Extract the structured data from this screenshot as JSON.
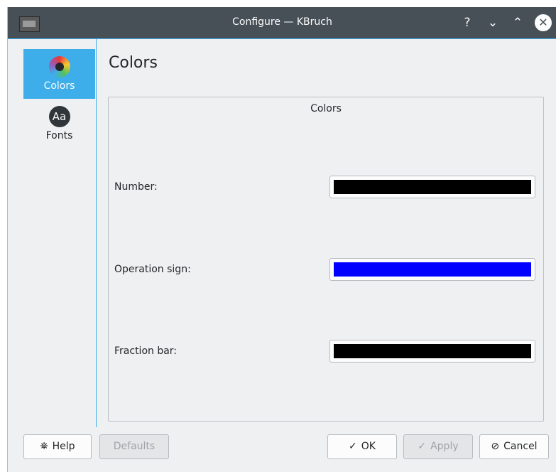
{
  "window": {
    "title": "Configure — KBruch",
    "controls": {
      "help": "?",
      "minimize": "⌄",
      "maximize": "⌃",
      "close": "✕"
    }
  },
  "sidebar": {
    "items": [
      {
        "label": "Colors",
        "icon": "colors-icon",
        "active": true
      },
      {
        "label": "Fonts",
        "icon": "fonts-icon",
        "icon_text": "Aa",
        "active": false
      }
    ]
  },
  "page": {
    "title": "Colors",
    "group_title": "Colors",
    "rows": [
      {
        "label": "Number:",
        "color": "#000000"
      },
      {
        "label": "Operation sign:",
        "color": "#0000ff"
      },
      {
        "label": "Fraction bar:",
        "color": "#000000"
      }
    ]
  },
  "buttons": {
    "help": "Help",
    "defaults": "Defaults",
    "ok": "OK",
    "apply": "Apply",
    "cancel": "Cancel"
  },
  "colors": {
    "accent": "#3daee9",
    "titlebar": "#475057",
    "background": "#eff0f1"
  }
}
